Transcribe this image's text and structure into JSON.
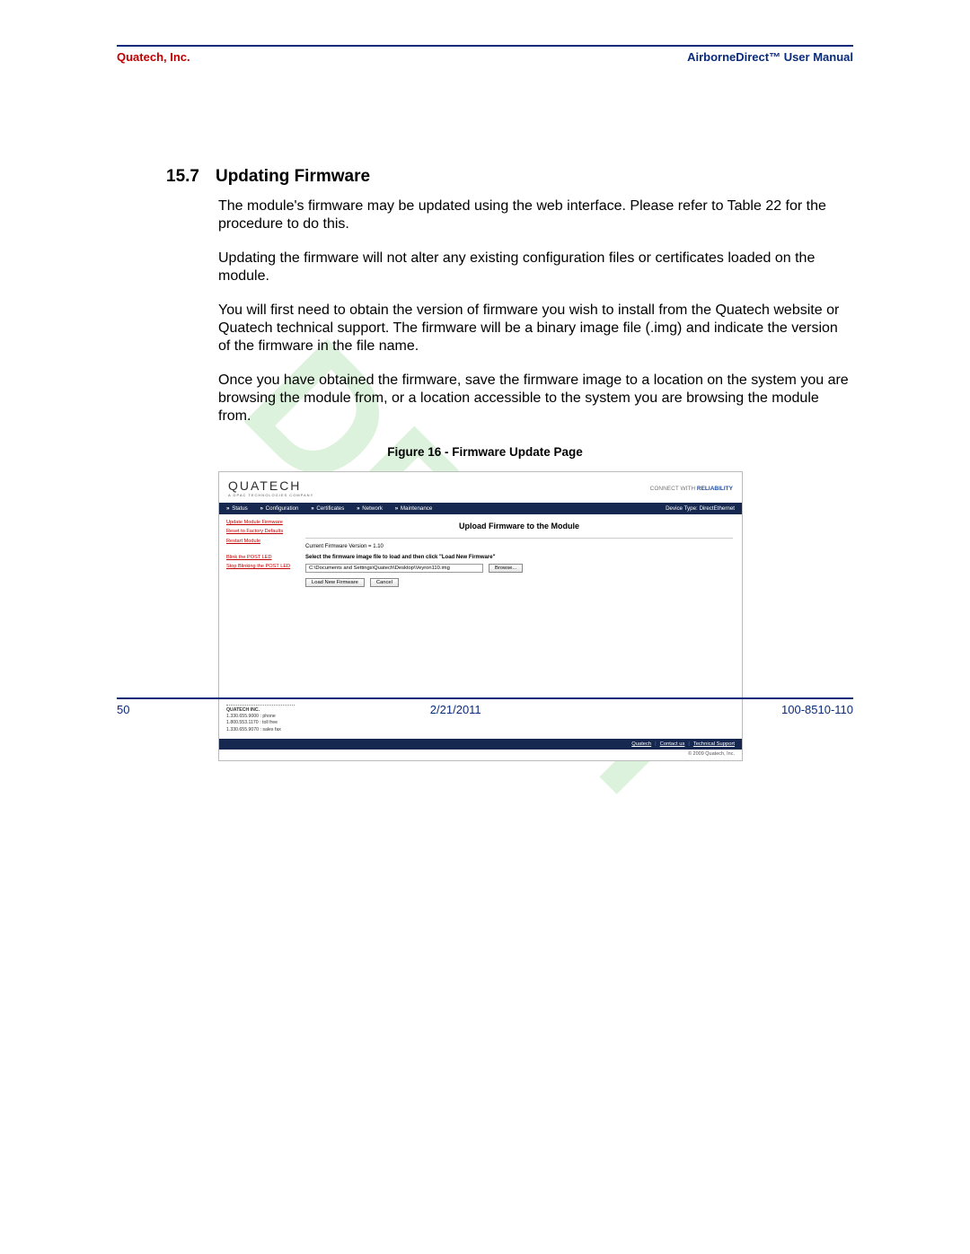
{
  "header": {
    "company": "Quatech, Inc.",
    "manual_title": "AirborneDirect™ User Manual"
  },
  "section": {
    "number": "15.7",
    "title": "Updating Firmware"
  },
  "paragraphs": [
    "The module's firmware may be updated using the web interface.  Please refer to Table 22 for the procedure to do this.",
    "Updating the firmware will not alter any existing configuration files or certificates loaded on the module.",
    "You will first need to obtain the version of firmware you wish to install from the Quatech website or Quatech technical support. The firmware will be a binary image file (.img) and indicate the version of the firmware in the file name.",
    "Once you have obtained the firmware, save the firmware image to a location on the system you are browsing the module from, or a location accessible to the system you are browsing the module from."
  ],
  "figure_caption": "Figure 16 - Firmware Update Page",
  "ui": {
    "logo": "QUATECH",
    "logo_sub": "A DPAC TECHNOLOGIES COMPANY",
    "tagline_prefix": "CONNECT WITH ",
    "tagline_bold": "RELIABILITY",
    "nav": {
      "items": [
        "Status",
        "Configuration",
        "Certificates",
        "Network",
        "Maintenance"
      ],
      "device_type": "Device Type: DirectEthernet"
    },
    "sidebar": {
      "group1": [
        "Update Module Firmware",
        "Reset to Factory Defaults",
        "Restart Module"
      ],
      "group2": [
        "Blink the POST LED",
        "Stop Blinking the POST LED"
      ],
      "contact": {
        "name": "QUATECH INC.",
        "lines": [
          "1.330.655.9000 :   phone",
          "1.800.553.1170 :   toll free",
          "1.330.655.9070 :   sales fax"
        ]
      }
    },
    "main": {
      "title": "Upload Firmware to the Module",
      "fw_version": "Current Firmware Version = 1.10",
      "instruction": "Select the firmware image file to load and then click \"Load New Firmware\"",
      "file_value": "C:\\Documents and Settings\\Quatech\\Desktop\\Veyron110.img",
      "browse": "Browse...",
      "load_btn": "Load New Firmware",
      "cancel_btn": "Cancel"
    },
    "footer_links": [
      "Quatech",
      "Contact us",
      "Technical Support"
    ],
    "copyright": "© 2009 Quatech, Inc."
  },
  "footer": {
    "page_number": "50",
    "date": "2/21/2011",
    "doc_number": "100-8510-110"
  }
}
